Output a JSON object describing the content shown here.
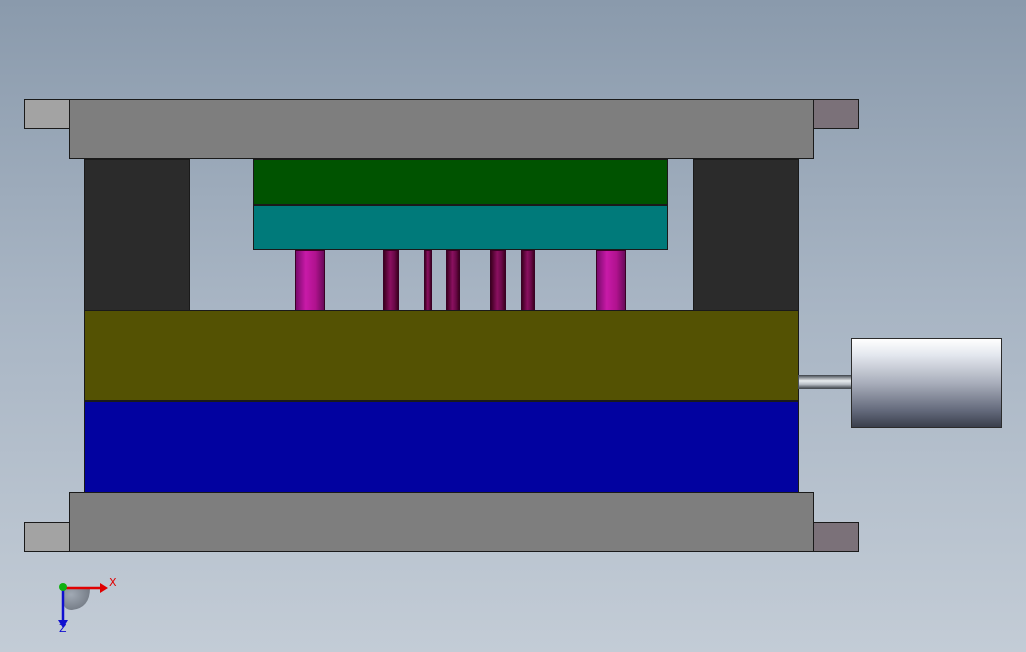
{
  "viewport": {
    "background_top": "#8a9aac",
    "background_bottom": "#c3ccd6"
  },
  "model": {
    "parts": [
      {
        "name": "top-clamp-plate",
        "color": "#7e7e7e"
      },
      {
        "name": "bottom-clamp-plate",
        "color": "#7e7e7e"
      },
      {
        "name": "spacer-blocks",
        "color": "#2b2b2b"
      },
      {
        "name": "ejector-retainer-plate",
        "color": "#005300"
      },
      {
        "name": "ejector-plate",
        "color": "#007a7a"
      },
      {
        "name": "return-pins",
        "color": "#c81aa8"
      },
      {
        "name": "ejector-pins",
        "color": "#8a1060"
      },
      {
        "name": "moving-mould-plate",
        "color": "#545203"
      },
      {
        "name": "fixed-mould-plate",
        "color": "#0202a0"
      },
      {
        "name": "hydraulic-cylinder",
        "color": "#a9aebb"
      }
    ]
  },
  "triad": {
    "x_label": "X",
    "z_label": "Z",
    "x_color": "#e00000",
    "z_color": "#1010d0",
    "y_color": "#10b010"
  }
}
